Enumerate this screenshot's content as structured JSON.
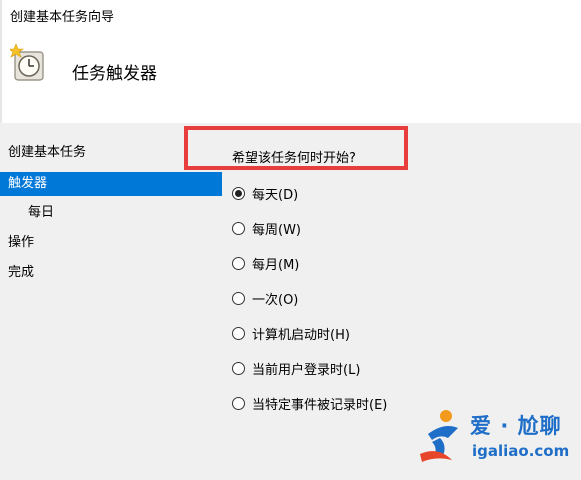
{
  "window": {
    "title": "创建基本任务向导"
  },
  "header": {
    "page_title": "任务触发器"
  },
  "nav": {
    "items": [
      {
        "label": "创建基本任务",
        "selected": false,
        "sub": false
      },
      {
        "label": "触发器",
        "selected": true,
        "sub": false
      },
      {
        "label": "每日",
        "selected": false,
        "sub": true
      },
      {
        "label": "操作",
        "selected": false,
        "sub": false
      },
      {
        "label": "完成",
        "selected": false,
        "sub": false
      }
    ]
  },
  "main": {
    "question": "希望该任务何时开始?",
    "options": [
      {
        "label": "每天(D)",
        "checked": true
      },
      {
        "label": "每周(W)",
        "checked": false
      },
      {
        "label": "每月(M)",
        "checked": false
      },
      {
        "label": "一次(O)",
        "checked": false
      },
      {
        "label": "计算机启动时(H)",
        "checked": false
      },
      {
        "label": "当前用户登录时(L)",
        "checked": false
      },
      {
        "label": "当特定事件被记录时(E)",
        "checked": false
      }
    ]
  },
  "watermark": {
    "name_part1": "爱",
    "separator": "·",
    "name_part2": "尬聊",
    "url": "igaliao.com"
  },
  "colors": {
    "selection": "#0078d7",
    "highlight": "#e83d3d",
    "watermark": "#1f6ec8",
    "panel_bg": "#f0f0f0"
  }
}
